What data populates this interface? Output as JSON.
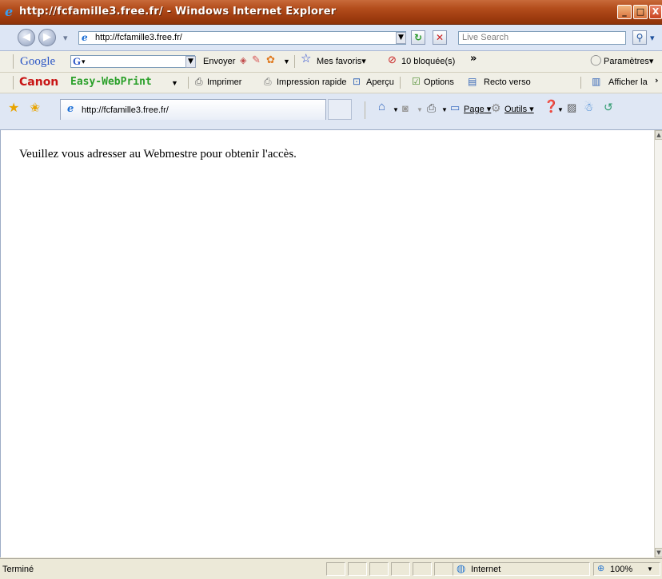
{
  "window": {
    "title": "http://fcfamille3.free.fr/ - Windows Internet Explorer",
    "minimize_label": "_",
    "maximize_label": "□",
    "close_label": "X"
  },
  "address_bar": {
    "url": "http://fcfamille3.free.fr/",
    "search_placeholder": "Live Search"
  },
  "google_toolbar": {
    "logo": "Google",
    "search_logo": "G",
    "send_label": "Envoyer",
    "bookmarks_label": "Mes favoris",
    "popups_label": "10 bloquée(s)",
    "overflow": "»",
    "settings_label": "Paramètres"
  },
  "canon_toolbar": {
    "brand": "Canon",
    "product": "Easy-WebPrint",
    "print_label": "Imprimer",
    "quick_print_label": "Impression rapide",
    "preview_label": "Aperçu",
    "options_label": "Options",
    "duplex_label": "Recto verso",
    "show_label": "Afficher la"
  },
  "tabs": {
    "active_label": "http://fcfamille3.free.fr/"
  },
  "command_bar": {
    "page_label": "Page",
    "tools_label": "Outils"
  },
  "page": {
    "message": "Veuillez vous adresser au Webmestre pour obtenir l'accès."
  },
  "status_bar": {
    "status_text": "Terminé",
    "zone_label": "Internet",
    "zoom_label": "100%"
  }
}
